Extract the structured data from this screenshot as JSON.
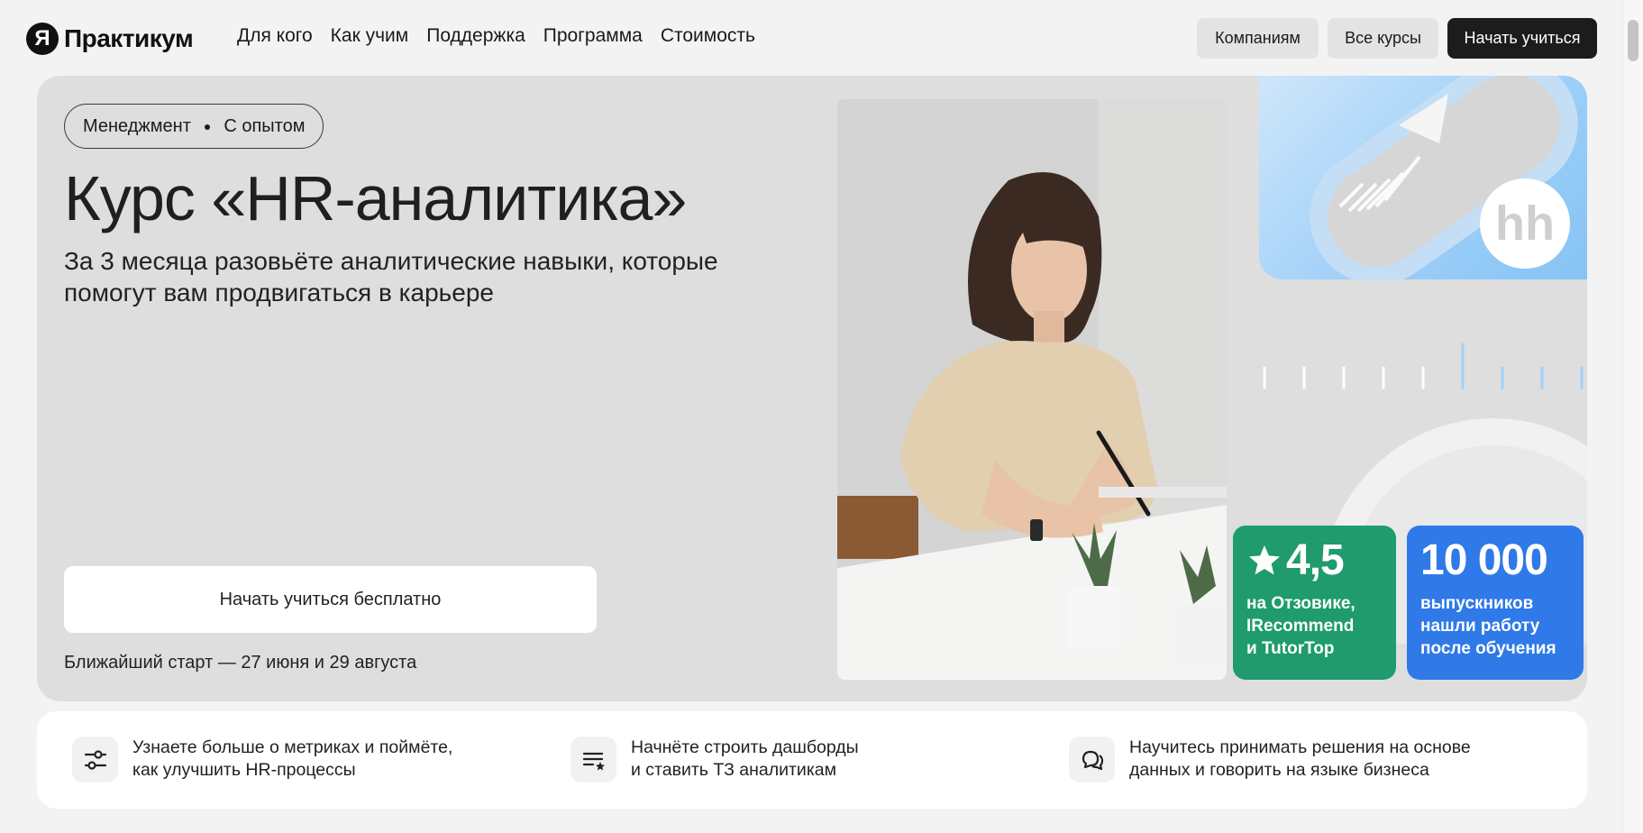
{
  "header": {
    "logo_letter": "Я",
    "logo_text": "Практикум",
    "nav": [
      "Для кого",
      "Как учим",
      "Поддержка",
      "Программа",
      "Стоимость"
    ],
    "btn_companies": "Компаниям",
    "btn_courses": "Все курсы",
    "btn_start": "Начать учиться"
  },
  "hero": {
    "chip_1": "Менеджмент",
    "chip_2": "С опытом",
    "title": "Курс «HR-аналитика»",
    "subtitle": "За 3 месяца разовьёте аналитические навыки, которые помогут вам продвигаться в карьере",
    "cta": "Начать учиться бесплатно",
    "start_date": "Ближайший старт — 27 июня и 29 августа",
    "hh_logo": "hh",
    "rating": {
      "value": "4,5",
      "line1": "на Отзовике,",
      "line2": "IRecommend",
      "line3": "и TutorTop"
    },
    "graduates": {
      "value": "10 000",
      "line1": "выпускников",
      "line2": "нашли работу",
      "line3": "после обучения"
    }
  },
  "features": [
    {
      "icon": "sliders-icon",
      "line1": "Узнаете больше о метриках и поймёте,",
      "line2": "как улучшить HR-процессы"
    },
    {
      "icon": "list-star-icon",
      "line1": "Начнёте строить дашборды",
      "line2": "и ставить ТЗ аналитикам"
    },
    {
      "icon": "chat-bubbles-icon",
      "line1": "Научитесь принимать решения на основе",
      "line2": "данных и говорить на языке бизнеса"
    }
  ],
  "colors": {
    "accent_dark": "#1c1c1c",
    "rating_badge": "#1f9b6e",
    "graduates_badge": "#2f79e8",
    "hh_card": "#9fd0f8"
  }
}
